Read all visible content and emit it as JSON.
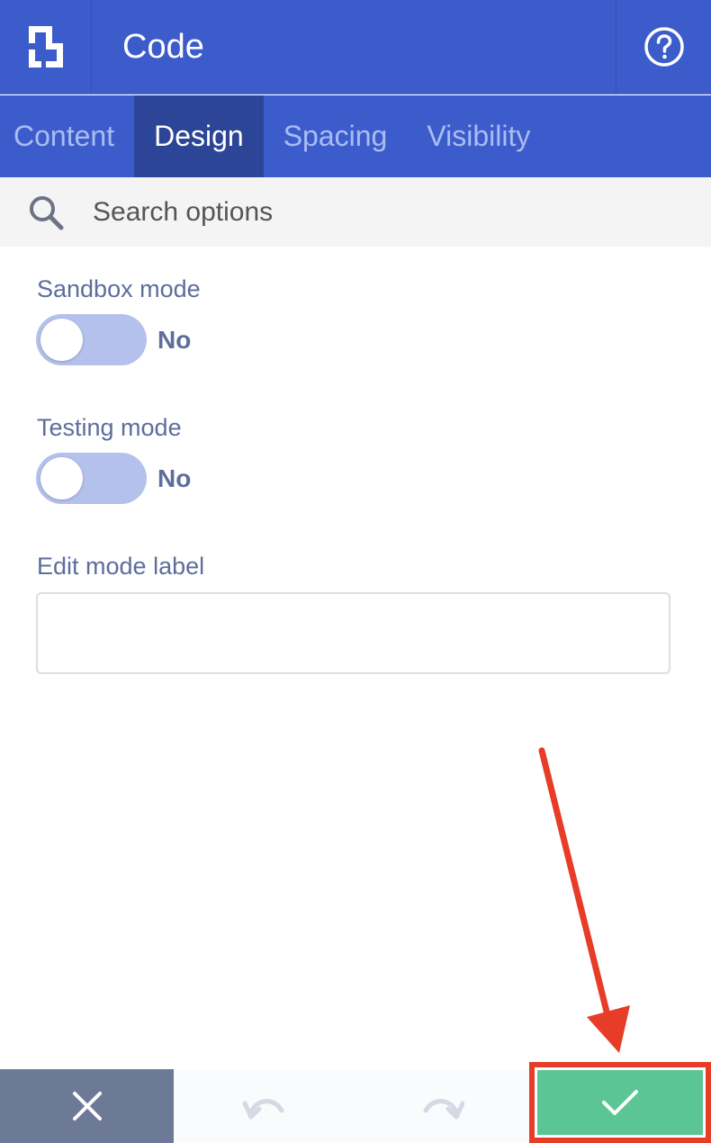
{
  "header": {
    "title": "Code",
    "logo_icon": "builder-logo-icon",
    "help_icon": "help-circle-icon"
  },
  "tabs": [
    {
      "label": "Content",
      "active": false
    },
    {
      "label": "Design",
      "active": true
    },
    {
      "label": "Spacing",
      "active": false
    },
    {
      "label": "Visibility",
      "active": false
    }
  ],
  "search": {
    "placeholder": "Search options",
    "value": ""
  },
  "fields": {
    "sandbox": {
      "label": "Sandbox mode",
      "toggle_text": "No",
      "on": false
    },
    "testing": {
      "label": "Testing mode",
      "toggle_text": "No",
      "on": false
    },
    "edit_label": {
      "label": "Edit mode label",
      "value": ""
    }
  },
  "footer": {
    "cancel_icon": "close-icon",
    "undo_icon": "undo-icon",
    "redo_icon": "redo-icon",
    "save_icon": "checkmark-icon"
  },
  "colors": {
    "header_bg": "#3d5ccc",
    "active_tab_bg": "#2d4597",
    "cancel_bg": "#6d7a97",
    "save_bg": "#5bc595",
    "annotation": "#e63c28"
  }
}
